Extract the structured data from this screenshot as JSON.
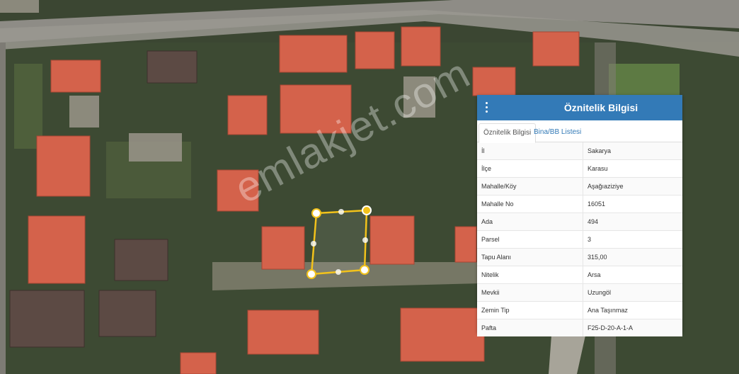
{
  "panel": {
    "title": "Öznitelik Bilgisi",
    "tabs": [
      {
        "label": "Öznitelik Bilgisi",
        "active": true
      },
      {
        "label": "Bina/BB Listesi",
        "active": false
      }
    ],
    "rows": [
      {
        "key": "İl",
        "value": "Sakarya"
      },
      {
        "key": "İlçe",
        "value": "Karasu"
      },
      {
        "key": "Mahalle/Köy",
        "value": "Aşağıaziziye"
      },
      {
        "key": "Mahalle No",
        "value": "16051"
      },
      {
        "key": "Ada",
        "value": "494"
      },
      {
        "key": "Parsel",
        "value": "3"
      },
      {
        "key": "Tapu Alanı",
        "value": "315,00"
      },
      {
        "key": "Nitelik",
        "value": "Arsa"
      },
      {
        "key": "Mevkii",
        "value": "Uzungöl"
      },
      {
        "key": "Zemin Tip",
        "value": "Ana Taşınmaz"
      },
      {
        "key": "Pafta",
        "value": "F25-D-20-A-1-A"
      }
    ]
  },
  "watermark": "emlakjet.com",
  "colors": {
    "header": "#337ab7",
    "parcel_outline": "#f2c21b",
    "roof": "#d9604a",
    "bottom_border": "#5cb85c"
  }
}
